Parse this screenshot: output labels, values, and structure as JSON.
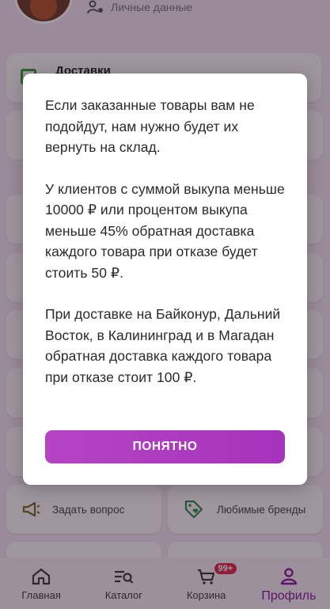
{
  "profile": {
    "personal_data_label": "Личные данные"
  },
  "cards": {
    "deliveries_title": "Доставки",
    "ask_question_label": "Задать вопрос",
    "favorite_brands_label": "Любимые бренды"
  },
  "modal": {
    "paragraphs": [
      "Если заказанные товары вам не подойдут, нам нужно будет их вернуть на склад.",
      "У клиентов с суммой выкупа меньше 10000 ₽ или процентом выкупа меньше 45% обратная доставка каждого товара при отказе будет стоить 50 ₽.",
      "При доставке на Байконур, Дальний Восток, в Калининград и в Магадан обратная доставка каждого товара при отказе стоит 100 ₽."
    ],
    "ok_label": "ПОНЯТНО"
  },
  "nav": {
    "home": "Главная",
    "catalog": "Каталог",
    "cart": "Корзина",
    "cart_badge": "99+",
    "profile": "Профиль"
  },
  "colors": {
    "accent": "#a534bb",
    "badge": "#e02b4a",
    "active_nav": "#8b1d9e"
  }
}
